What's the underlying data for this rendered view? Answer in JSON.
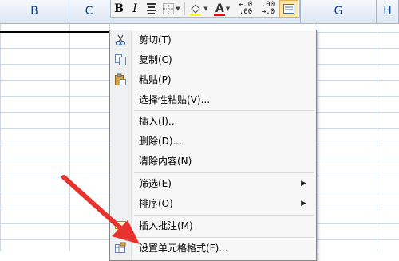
{
  "columns": [
    {
      "label": "B"
    },
    {
      "label": "C"
    },
    {
      "label": "G"
    },
    {
      "label": "H"
    }
  ],
  "toolbar": {
    "bold_label": "B",
    "italic_label": "I",
    "font_color_label": "A",
    "increase_decimal_label": ".0 ←.00",
    "decrease_decimal_label": ".00 →.0",
    "fill_color": "#ffff00",
    "font_color": "#ff0000"
  },
  "menu": {
    "cut": "剪切(T)",
    "copy": "复制(C)",
    "paste": "粘贴(P)",
    "paste_special": "选择性粘贴(V)...",
    "insert": "插入(I)...",
    "delete": "删除(D)...",
    "clear_contents": "清除内容(N)",
    "filter": "筛选(E)",
    "sort": "排序(O)",
    "insert_comment": "插入批注(M)",
    "format_cells": "设置单元格格式(F)..."
  },
  "colors": {
    "annotation_arrow": "#e8322e",
    "header_text": "#15428b",
    "grid_line": "#d0d7e5"
  }
}
